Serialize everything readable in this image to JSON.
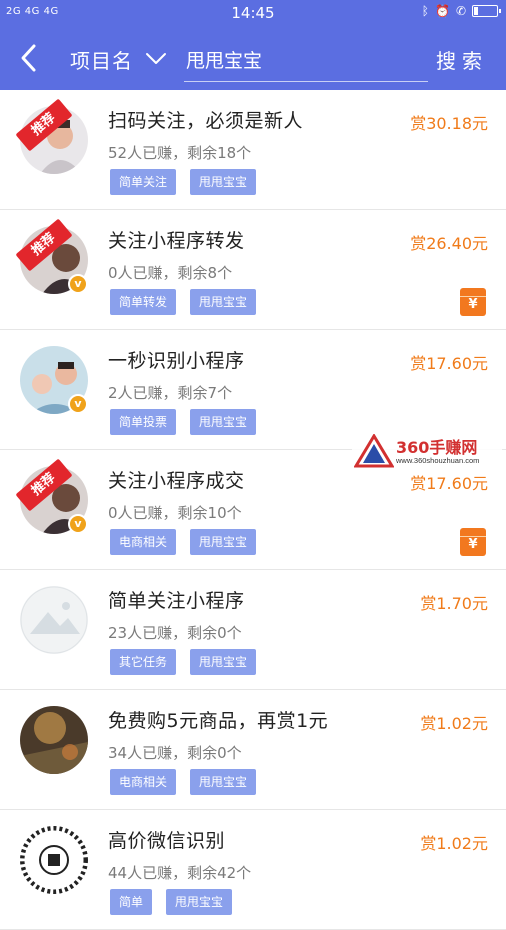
{
  "status_bar": {
    "left": "2G 4G 4G",
    "time": "14:45",
    "right_icons": [
      "bluetooth-icon",
      "alarm-icon",
      "volte-icon",
      "battery-icon"
    ]
  },
  "nav": {
    "category": "项目名",
    "search_value": "甩甩宝宝",
    "search_label": "搜索"
  },
  "colors": {
    "primary": "#5b6ee1",
    "reward": "#f07b1a",
    "tag": "#8aa0ec",
    "ribbon": "#e2262c",
    "badge": "#f0a21a"
  },
  "items": [
    {
      "title": "扫码关注，必须是新人",
      "reward": "赏30.18元",
      "stats": "52人已赚，剩余18个",
      "tags": [
        "简单关注",
        "甩甩宝宝"
      ],
      "recommended": "推荐",
      "verified": false,
      "hongbao": false
    },
    {
      "title": "关注小程序转发",
      "reward": "赏26.40元",
      "stats": "0人已赚，剩余8个",
      "tags": [
        "简单转发",
        "甩甩宝宝"
      ],
      "recommended": "推荐",
      "verified": "v",
      "hongbao": "¥"
    },
    {
      "title": "一秒识别小程序",
      "reward": "赏17.60元",
      "stats": "2人已赚，剩余7个",
      "tags": [
        "简单投票",
        "甩甩宝宝"
      ],
      "recommended": "",
      "verified": "v",
      "hongbao": false
    },
    {
      "title": "关注小程序成交",
      "reward": "赏17.60元",
      "stats": "0人已赚，剩余10个",
      "tags": [
        "电商相关",
        "甩甩宝宝"
      ],
      "recommended": "推荐",
      "verified": "v",
      "hongbao": "¥"
    },
    {
      "title": "简单关注小程序",
      "reward": "赏1.70元",
      "stats": "23人已赚，剩余0个",
      "tags": [
        "其它任务",
        "甩甩宝宝"
      ],
      "recommended": "",
      "verified": false,
      "hongbao": false
    },
    {
      "title": "免费购5元商品，再赏1元",
      "reward": "赏1.02元",
      "stats": "34人已赚，剩余0个",
      "tags": [
        "电商相关",
        "甩甩宝宝"
      ],
      "recommended": "",
      "verified": false,
      "hongbao": false
    },
    {
      "title": "高价微信识别",
      "reward": "赏1.02元",
      "stats": "44人已赚，剩余42个",
      "tags": [
        "简单",
        "甩甩宝宝"
      ],
      "recommended": "",
      "verified": false,
      "hongbao": false
    }
  ],
  "watermark": {
    "name": "360手赚网",
    "url": "www.360shouzhuan.com"
  }
}
